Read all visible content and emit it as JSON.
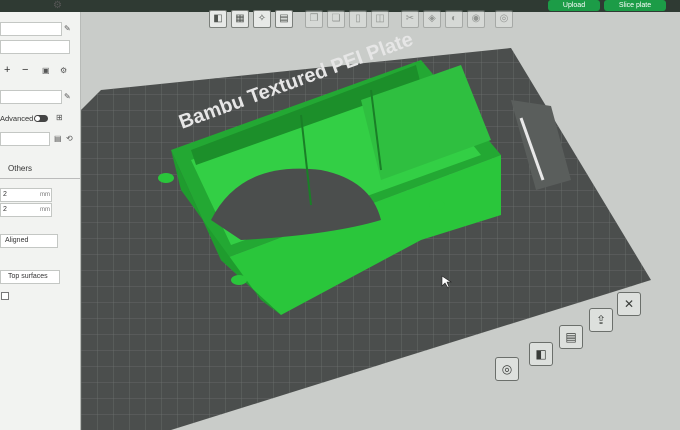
{
  "topbar": {
    "upload": "Upload",
    "slice_plate": "Slice plate"
  },
  "left_panel": {
    "advanced_label": "Advanced",
    "tab_others": "Others",
    "plus_symbol": "+",
    "minus_symbol": "−",
    "row1": {
      "value": "2",
      "unit": "mm"
    },
    "row2": {
      "value": "2",
      "unit": "mm"
    },
    "aligned": "Aligned",
    "top_surfaces": "Top surfaces"
  },
  "plate": {
    "label": "Bambu Textured PEI Plate"
  },
  "icons": {
    "top_left": "gear-icon",
    "toolbar": [
      "cube-icon",
      "grid-icon",
      "arrange-icon",
      "layers-icon",
      "copy-icon",
      "paste-icon",
      "delete-icon",
      "cut-icon",
      "support-icon",
      "paint-icon",
      "seam-icon",
      "text-icon",
      "measure-icon"
    ],
    "viewport": [
      "view-icon",
      "perspective-icon",
      "save-icon",
      "export-icon",
      "close-icon"
    ]
  },
  "colors": {
    "accent": "#1c9c47",
    "model": "#27c23a",
    "bed": "#4b4e4d"
  }
}
